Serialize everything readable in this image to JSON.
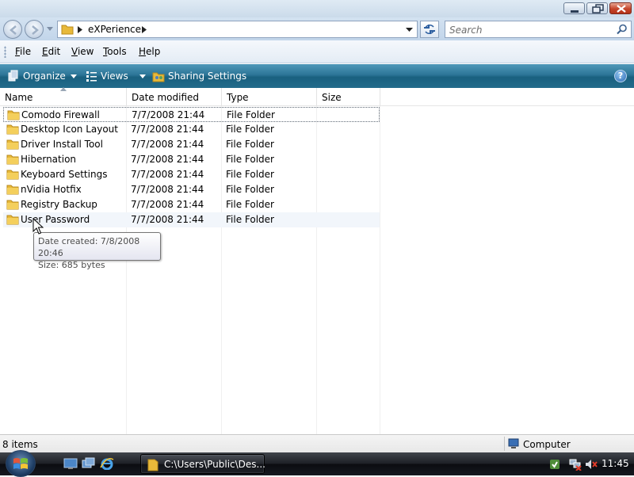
{
  "address": {
    "path_segments": [
      "eXPerience"
    ],
    "back_icon": "back-arrow-icon",
    "forward_icon": "forward-arrow-icon"
  },
  "search": {
    "placeholder": "Search"
  },
  "menu": {
    "items": [
      {
        "first": "F",
        "rest": "ile"
      },
      {
        "first": "E",
        "rest": "dit"
      },
      {
        "first": "V",
        "rest": "iew"
      },
      {
        "first": "T",
        "rest": "ools"
      },
      {
        "first": "H",
        "rest": "elp"
      }
    ]
  },
  "commands": {
    "organize": "Organize",
    "views": "Views",
    "sharing": "Sharing Settings",
    "help": "?"
  },
  "columns": [
    "Name",
    "Date modified",
    "Type",
    "Size"
  ],
  "files": [
    {
      "name": "Comodo Firewall",
      "date": "7/7/2008 21:44",
      "type": "File Folder",
      "size": ""
    },
    {
      "name": "Desktop Icon Layout",
      "date": "7/7/2008 21:44",
      "type": "File Folder",
      "size": ""
    },
    {
      "name": "Driver Install Tool",
      "date": "7/7/2008 21:44",
      "type": "File Folder",
      "size": ""
    },
    {
      "name": "Hibernation",
      "date": "7/7/2008 21:44",
      "type": "File Folder",
      "size": ""
    },
    {
      "name": "Keyboard Settings",
      "date": "7/7/2008 21:44",
      "type": "File Folder",
      "size": ""
    },
    {
      "name": "nVidia Hotfix",
      "date": "7/7/2008 21:44",
      "type": "File Folder",
      "size": ""
    },
    {
      "name": "Registry Backup",
      "date": "7/7/2008 21:44",
      "type": "File Folder",
      "size": ""
    },
    {
      "name": "User Password",
      "date": "7/7/2008 21:44",
      "type": "File Folder",
      "size": ""
    }
  ],
  "tooltip": {
    "line1": "Date created: 7/8/2008 20:46",
    "line2": "Size: 685 bytes"
  },
  "status": {
    "count": "8 items",
    "zone": "Computer"
  },
  "taskbar": {
    "window_label": "C:\\Users\\Public\\Des...",
    "clock": "11:45"
  },
  "colors": {
    "command_bar": "#236b8b",
    "selection_border": "#606a76",
    "folder": "#e8b93a"
  }
}
